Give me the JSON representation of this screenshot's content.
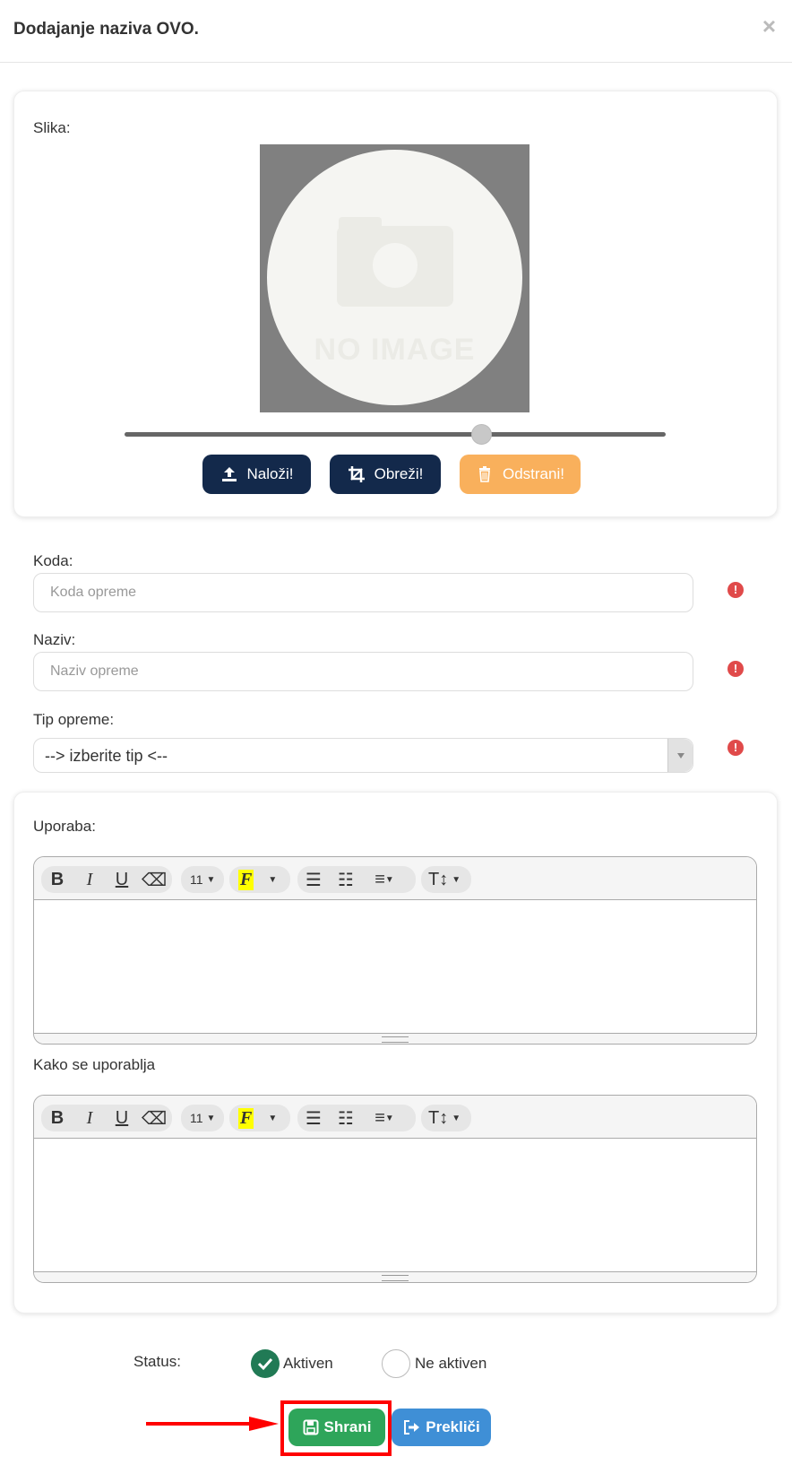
{
  "modal": {
    "title": "Dodajanje naziva OVO.",
    "close_icon": "times-icon"
  },
  "image_section": {
    "label": "Slika:",
    "placeholder_text": "NO IMAGE",
    "zoom_slider_value": 0.66,
    "buttons": {
      "upload": "Naloži!",
      "crop": "Obreži!",
      "remove": "Odstrani!"
    }
  },
  "form": {
    "code": {
      "label": "Koda:",
      "placeholder": "Koda opreme",
      "value": ""
    },
    "name": {
      "label": "Naziv:",
      "placeholder": "Naziv opreme",
      "value": ""
    },
    "type": {
      "label": "Tip opreme:",
      "selected": "--> izberite tip <--"
    },
    "required_icon": "exclamation-circle-icon"
  },
  "editors": [
    {
      "label": "Uporaba:",
      "font_size": "11"
    },
    {
      "label": "Kako se uporablja",
      "font_size": "11"
    }
  ],
  "status": {
    "label": "Status:",
    "active": "Aktiven",
    "inactive": "Ne aktiven",
    "selected": "Aktiven"
  },
  "actions": {
    "save": "Shrani",
    "cancel": "Prekliči"
  },
  "colors": {
    "dark_button": "#13294b",
    "remove_button": "#f9b05c",
    "save_button": "#2ea55a",
    "cancel_button": "#3f8fd6",
    "radio_active": "#217a55",
    "required_icon": "#e04a4a",
    "highlight": "#ff0000"
  }
}
